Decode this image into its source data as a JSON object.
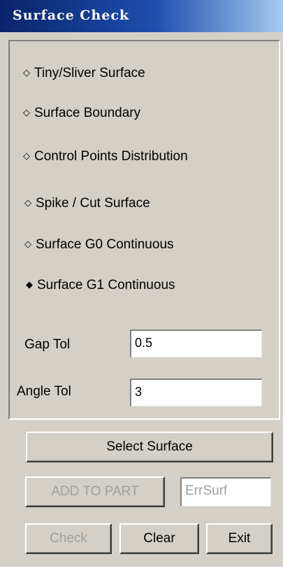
{
  "window": {
    "title": "Surface Check"
  },
  "options": [
    {
      "label": "Tiny/Sliver Surface",
      "selected": false
    },
    {
      "label": "Surface Boundary",
      "selected": false
    },
    {
      "label": "Control Points Distribution",
      "selected": false
    },
    {
      "label": "Spike / Cut Surface",
      "selected": false
    },
    {
      "label": "Surface G0 Continuous",
      "selected": false
    },
    {
      "label": "Surface G1 Continuous",
      "selected": true
    }
  ],
  "glyphs": {
    "unselected": "◇",
    "selected": "◆"
  },
  "gap_tol": {
    "label": "Gap Tol",
    "value": "0.5"
  },
  "angle_tol": {
    "label": "Angle Tol",
    "value": "3"
  },
  "buttons": {
    "select_surface": "Select Surface",
    "add_to_part": "ADD TO PART",
    "check": "Check",
    "clear": "Clear",
    "exit": "Exit"
  },
  "part_name": {
    "value": "ErrSurf"
  },
  "colors": {
    "face": "#d4d0c8",
    "title_start": "#0a246a",
    "title_end": "#a6caf0",
    "disabled_text": "#a0a0a0"
  }
}
